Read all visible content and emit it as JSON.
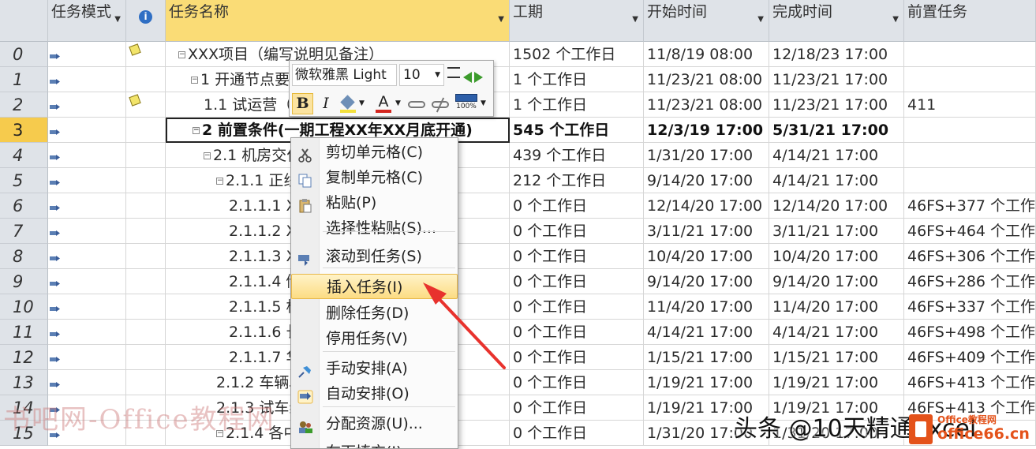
{
  "headers": {
    "mode": "任务模式",
    "info": "i",
    "name": "任务名称",
    "duration": "工期",
    "start": "开始时间",
    "finish": "完成时间",
    "pred": "前置任务"
  },
  "rows": [
    {
      "id": "0",
      "name": "XXX项目（编写说明见备注）",
      "duration": "1502 个工作日",
      "start": "11/8/19 08:00",
      "finish": "12/18/23 17:00",
      "pred": ""
    },
    {
      "id": "1",
      "name": "1 开通节点要求",
      "duration": "1 个工作日",
      "start": "11/23/21 08:00",
      "finish": "11/23/21 17:00",
      "pred": ""
    },
    {
      "id": "2",
      "name": "1.1 试运营（",
      "duration": "1 个工作日",
      "start": "11/23/21 08:00",
      "finish": "11/23/21 17:00",
      "pred": "411"
    },
    {
      "id": "3",
      "name": "2 前置条件(一期工程XX年XX月底开通)",
      "duration": "545 个工作日",
      "start": "12/3/19 17:00",
      "finish": "5/31/21 17:00",
      "pred": ""
    },
    {
      "id": "4",
      "name": "2.1 机房交付",
      "duration": "439 个工作日",
      "start": "1/31/20 17:00",
      "finish": "4/14/21 17:00",
      "pred": ""
    },
    {
      "id": "5",
      "name": "2.1.1 正线机",
      "duration": "212 个工作日",
      "start": "9/14/20 17:00",
      "finish": "4/14/21 17:00",
      "pred": ""
    },
    {
      "id": "6",
      "name": "2.1.1.1 XX",
      "duration": "0 个工作日",
      "start": "12/14/20 17:00",
      "finish": "12/14/20 17:00",
      "pred": "46FS+377 个工作日"
    },
    {
      "id": "7",
      "name": "2.1.1.2 XX",
      "duration": "0 个工作日",
      "start": "3/11/21 17:00",
      "finish": "3/11/21 17:00",
      "pred": "46FS+464 个工作日"
    },
    {
      "id": "8",
      "name": "2.1.1.3 XX",
      "duration": "0 个工作日",
      "start": "10/4/20 17:00",
      "finish": "10/4/20 17:00",
      "pred": "46FS+306 个工作日"
    },
    {
      "id": "9",
      "name": "2.1.1.4 储",
      "duration": "0 个工作日",
      "start": "9/14/20 17:00",
      "finish": "9/14/20 17:00",
      "pred": "46FS+286 个工作日"
    },
    {
      "id": "10",
      "name": "2.1.1.5 杭",
      "duration": "0 个工作日",
      "start": "11/4/20 17:00",
      "finish": "11/4/20 17:00",
      "pred": "46FS+337 个工作日"
    },
    {
      "id": "11",
      "name": "2.1.1.6 长",
      "duration": "0 个工作日",
      "start": "4/14/21 17:00",
      "finish": "4/14/21 17:00",
      "pred": "46FS+498 个工作日"
    },
    {
      "id": "12",
      "name": "2.1.1.7 华",
      "duration": "0 个工作日",
      "start": "1/15/21 17:00",
      "finish": "1/15/21 17:00",
      "pred": "46FS+409 个工作日"
    },
    {
      "id": "13",
      "name": "2.1.2 车辆段",
      "duration": "0 个工作日",
      "start": "1/19/21 17:00",
      "finish": "1/19/21 17:00",
      "pred": "46FS+413 个工作日"
    },
    {
      "id": "14",
      "name": "2.1.3 试车线",
      "duration": "0 个工作日",
      "start": "1/19/21 17:00",
      "finish": "1/19/21 17:00",
      "pred": "46FS+413 个工作日"
    },
    {
      "id": "15",
      "name": "2.1.4 各中心",
      "duration": "0 个工作日",
      "start": "1/31/20 17:00",
      "finish": "1/31/20 17:00",
      "pred": ""
    }
  ],
  "toolbar": {
    "font": "微软雅黑 Light",
    "size": "10",
    "bold": "B",
    "italic": "I",
    "font_color": "A",
    "zoom": "100%"
  },
  "context_menu": [
    {
      "label": "剪切单元格(C)",
      "icon": "scissors-icon"
    },
    {
      "label": "复制单元格(C)",
      "icon": "copy-icon"
    },
    {
      "label": "粘贴(P)",
      "icon": "paste-icon"
    },
    {
      "label": "选择性粘贴(S)...",
      "icon": ""
    },
    {
      "label": "滚动到任务(S)",
      "icon": "scroll-to-task-icon"
    },
    {
      "label": "插入任务(I)",
      "icon": ""
    },
    {
      "label": "删除任务(D)",
      "icon": ""
    },
    {
      "label": "停用任务(V)",
      "icon": ""
    },
    {
      "label": "手动安排(A)",
      "icon": "pin-icon"
    },
    {
      "label": "自动安排(O)",
      "icon": "auto-schedule-icon"
    },
    {
      "label": "分配资源(U)...",
      "icon": "assign-resources-icon"
    },
    {
      "label": "在下填充(I)",
      "icon": ""
    }
  ],
  "watermarks": {
    "left": "书吧网-Office教程网",
    "right_author": "头条 @10天精通Excel",
    "logo_site": "office66.cn",
    "logo_brand": "Office教程网"
  },
  "colors": {
    "header_bg": "#dfe3e8",
    "selected_header": "#fadc76",
    "selected_row": "#f6cb4d",
    "arrow": "#e8322d"
  }
}
